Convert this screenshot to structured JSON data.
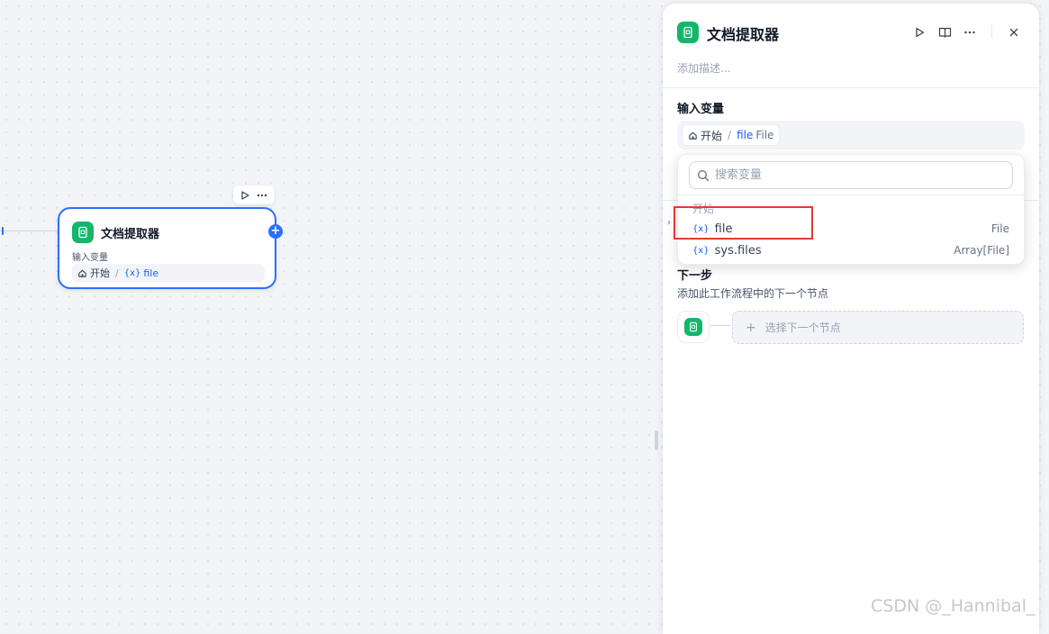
{
  "canvas": {
    "node": {
      "title": "文档提取器",
      "input_label": "输入变量",
      "var_source": "开始",
      "var_sep": "/",
      "var_icon": "{x}",
      "var_name": "file",
      "add_handle": "+"
    }
  },
  "panel": {
    "title": "文档提取器",
    "description_placeholder": "添加描述...",
    "input_section": "输入变量",
    "selected_var": {
      "source": "开始",
      "sep": "/",
      "name": "file",
      "type": "File"
    },
    "next_step": {
      "title": "下一步",
      "description": "添加此工作流程中的下一个节点",
      "button_icon": "+",
      "button_label": "选择下一个节点"
    },
    "icons": [
      "document-icon",
      "run-icon",
      "book-icon",
      "more-icon",
      "close-icon"
    ]
  },
  "dropdown": {
    "search_placeholder": "搜索变量",
    "group": "开始",
    "items": [
      {
        "icon": "{x}",
        "name": "file",
        "type": "File"
      },
      {
        "icon": "{x}",
        "name": "sys.files",
        "type": "Array[File]"
      }
    ]
  },
  "colors": {
    "accent": "#2970ff",
    "node_icon": "#12b76a",
    "highlight": "#e53935"
  },
  "watermark": "CSDN @_Hannibal_"
}
